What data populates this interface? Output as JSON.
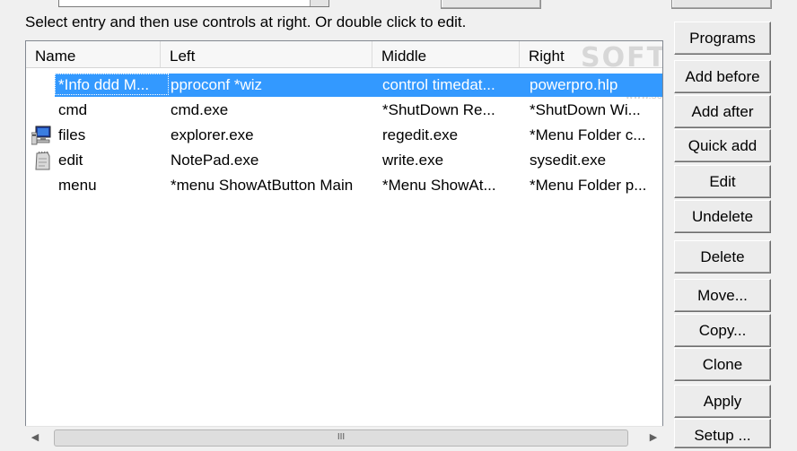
{
  "instructions": "Select entry and then use controls at right.  Or double click to edit.",
  "watermark": {
    "text": "SOFTPEDIA",
    "sub": "www.softpedia.com"
  },
  "columns": {
    "name": "Name",
    "left": "Left",
    "middle": "Middle",
    "right": "Right"
  },
  "rows": [
    {
      "name": "*Info ddd M...",
      "left": "pproconf *wiz",
      "middle": "control timedat...",
      "right": "powerpro.hlp",
      "icon": "none",
      "selected": true
    },
    {
      "name": "cmd",
      "left": "cmd.exe",
      "middle": "*ShutDown Re...",
      "right": "*ShutDown Wi...",
      "icon": "none",
      "selected": false
    },
    {
      "name": "files",
      "left": "explorer.exe",
      "middle": "regedit.exe",
      "right": "*Menu Folder c...",
      "icon": "computer-icon",
      "selected": false
    },
    {
      "name": "edit",
      "left": "NotePad.exe",
      "middle": "write.exe",
      "right": "sysedit.exe",
      "icon": "document-icon",
      "selected": false
    },
    {
      "name": "menu",
      "left": "*menu ShowAtButton Main",
      "middle": "*Menu ShowAt...",
      "right": "*Menu Folder p...",
      "icon": "none",
      "selected": false
    }
  ],
  "scrollbar": {
    "thumb_grip": "III"
  },
  "buttons": {
    "programs": "Programs",
    "add_before": "Add before",
    "add_after": "Add after",
    "quick_add": "Quick add",
    "edit": "Edit",
    "undelete": "Undelete",
    "delete": "Delete",
    "move": "Move...",
    "copy": "Copy...",
    "clone": "Clone",
    "apply": "Apply",
    "setup": "Setup ..."
  },
  "colors": {
    "selection": "#3399ff",
    "background": "#f0f0f0"
  }
}
